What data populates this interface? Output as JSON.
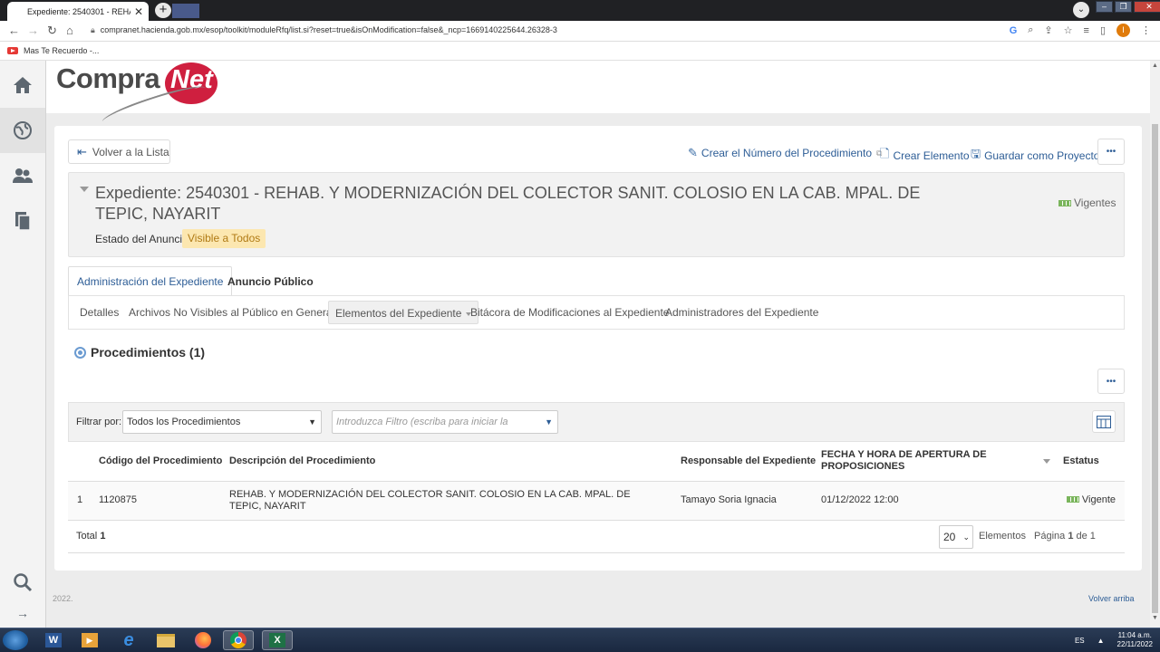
{
  "browser": {
    "tab_title": "Expediente: 2540301 - REHAB. Y",
    "tab_close": "✕",
    "new_tab": "+",
    "url": "compranet.hacienda.gob.mx/esop/toolkit/moduleRfq/list.si?reset=true&isOnModification=false&_ncp=1669140225644.26328-3",
    "profile_initial": "I",
    "bookmark": "Mas Te Recuerdo -..."
  },
  "logo": {
    "part1": "Compra",
    "part2": "Net"
  },
  "toolbar": {
    "back": "Volver a la Lista",
    "create_number": "Crear el Número del Procedimiento",
    "create_element": "Crear Elemento",
    "save_project": "Guardar como Proyecto",
    "more": "•••"
  },
  "expediente": {
    "title": "Expediente: 2540301 - REHAB. Y MODERNIZACIÓN DEL COLECTOR SANIT. COLOSIO EN LA CAB. MPAL. DE TEPIC, NAYARIT",
    "estado_label": "Estado del Anuncio:",
    "estado_value": "Visible a Todos",
    "status": "Vigentes"
  },
  "tabs": {
    "admin": "Administración del Expediente",
    "public": "Anuncio Público"
  },
  "subtabs": {
    "detalles": "Detalles",
    "archivos": "Archivos No Visibles al Público en General",
    "elementos": "Elementos del Expediente",
    "bitacora": "Bitácora de Modificaciones al Expediente",
    "administradores": "Administradores del Expediente"
  },
  "procedimientos": {
    "title": "Procedimientos (1)",
    "more": "•••",
    "filter_label": "Filtrar por:",
    "filter_select": "Todos los Procedimientos",
    "filter_placeholder": "Introduzca Filtro (escriba para iniciar la",
    "columns": {
      "codigo": "Código del Procedimiento",
      "descripcion": "Descripción del Procedimiento",
      "responsable": "Responsable del Expediente",
      "fecha": "FECHA Y HORA DE APERTURA DE PROPOSICIONES",
      "estatus": "Estatus"
    },
    "rows": [
      {
        "index": "1",
        "codigo": "1120875",
        "descripcion": "REHAB. Y MODERNIZACIÓN DEL COLECTOR SANIT. COLOSIO EN LA CAB. MPAL. DE TEPIC, NAYARIT",
        "responsable": "Tamayo Soria Ignacia",
        "fecha": "01/12/2022 12:00",
        "estatus": "Vigente"
      }
    ],
    "total_label": "Total",
    "total_value": "1",
    "page_size": "20",
    "elementos_label": "Elementos",
    "pagina_label": "Página",
    "pagina_current": "1",
    "pagina_de": "de 1"
  },
  "footer": {
    "year": "2022.",
    "back_to_top": "Volver arriba"
  },
  "taskbar": {
    "lang": "ES",
    "time": "11:04 a.m.",
    "date": "22/11/2022"
  },
  "colors": {
    "link": "#2d5d96",
    "badge_bg": "#fce7b0",
    "badge_text": "#b07a14",
    "status_green": "#7ab55c",
    "logo_red": "#cf1f3f"
  }
}
